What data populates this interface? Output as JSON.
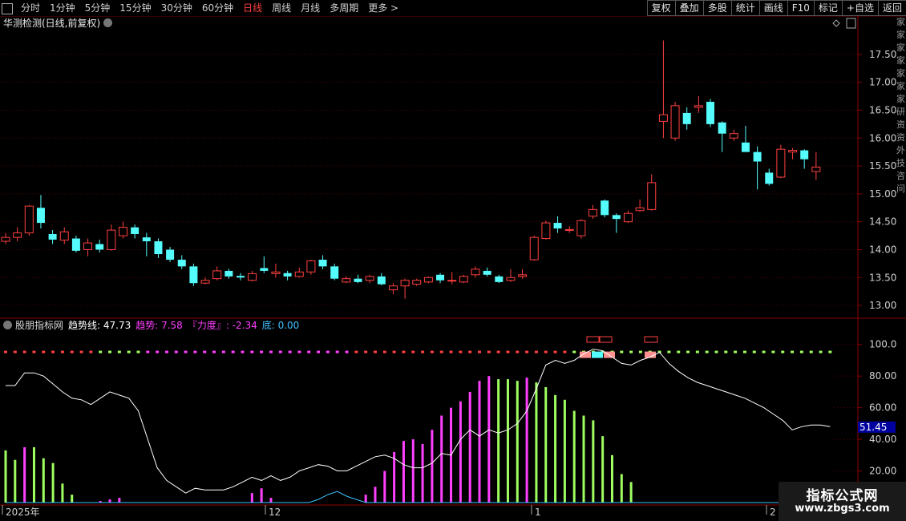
{
  "toolbar": {
    "tabs": [
      "分时",
      "1分钟",
      "5分钟",
      "15分钟",
      "30分钟",
      "60分钟",
      "日线",
      "周线",
      "月线",
      "多周期",
      "更多 >"
    ],
    "active_tab": 6,
    "right_buttons": [
      "复权",
      "叠加",
      "多股",
      "统计",
      "画线",
      "F10",
      "标记",
      "+自选",
      "返回"
    ]
  },
  "chart_title": "华测检测(日线,前复权)",
  "indicator_title": {
    "name": "股朋指标网",
    "trend_line": "趋势线: 47.73",
    "trend": "趋势: 7.58",
    "force": "『力度』: -2.34",
    "bottom": "底: 0.00"
  },
  "price_ticks": [
    "17.50",
    "17.00",
    "16.50",
    "16.00",
    "15.50",
    "15.00",
    "14.50",
    "14.00",
    "13.50",
    "13.00"
  ],
  "indicator_ticks": [
    "100.0",
    "80.00",
    "60.00",
    "40.00",
    "20.00"
  ],
  "current_value_badge": "51.45",
  "date_labels": [
    "2025年",
    "12",
    "1",
    "2"
  ],
  "right_strip": [
    "家",
    "家",
    "家",
    "家",
    "家",
    "家",
    "家",
    "研",
    "资",
    "资",
    "外",
    "技",
    "咨",
    "问"
  ],
  "watermark": {
    "line1": "指标公式网",
    "line2": "www.zbgs3.com"
  },
  "colors": {
    "up": "#ff4040",
    "down": "#54fcfc",
    "pink": "#ff40ff",
    "green": "#a0ff60",
    "axis": "#8b0000"
  },
  "chart_data": [
    {
      "type": "candlestick",
      "title": "华测检测(日线,前复权)",
      "ylim": [
        12.8,
        17.9
      ],
      "candles": [
        [
          14.15,
          14.22,
          14.3,
          14.1
        ],
        [
          14.22,
          14.3,
          14.4,
          14.15
        ],
        [
          14.3,
          14.78,
          14.8,
          14.25
        ],
        [
          14.75,
          14.48,
          14.98,
          14.38
        ],
        [
          14.28,
          14.18,
          14.35,
          14.1
        ],
        [
          14.17,
          14.32,
          14.4,
          14.1
        ],
        [
          14.2,
          13.98,
          14.25,
          13.95
        ],
        [
          14.0,
          14.12,
          14.2,
          13.88
        ],
        [
          14.1,
          14.0,
          14.18,
          13.95
        ],
        [
          14.0,
          14.35,
          14.45,
          13.98
        ],
        [
          14.25,
          14.4,
          14.5,
          14.2
        ],
        [
          14.4,
          14.28,
          14.45,
          14.2
        ],
        [
          14.22,
          14.15,
          14.3,
          13.88
        ],
        [
          14.15,
          13.92,
          14.2,
          13.85
        ],
        [
          14.0,
          13.82,
          14.05,
          13.78
        ],
        [
          13.82,
          13.7,
          13.9,
          13.65
        ],
        [
          13.7,
          13.4,
          13.75,
          13.35
        ],
        [
          13.4,
          13.45,
          13.5,
          13.38
        ],
        [
          13.48,
          13.62,
          13.7,
          13.45
        ],
        [
          13.62,
          13.52,
          13.66,
          13.48
        ],
        [
          13.53,
          13.5,
          13.58,
          13.45
        ],
        [
          13.45,
          13.57,
          13.62,
          13.43
        ],
        [
          13.67,
          13.62,
          13.88,
          13.58
        ],
        [
          13.57,
          13.6,
          13.75,
          13.5
        ],
        [
          13.58,
          13.52,
          13.62,
          13.45
        ],
        [
          13.52,
          13.6,
          13.68,
          13.5
        ],
        [
          13.6,
          13.8,
          13.82,
          13.55
        ],
        [
          13.82,
          13.7,
          13.9,
          13.65
        ],
        [
          13.7,
          13.48,
          13.75,
          13.45
        ],
        [
          13.42,
          13.48,
          13.52,
          13.4
        ],
        [
          13.48,
          13.42,
          13.55,
          13.4
        ],
        [
          13.45,
          13.52,
          13.55,
          13.4
        ],
        [
          13.52,
          13.38,
          13.58,
          13.36
        ],
        [
          13.28,
          13.35,
          13.4,
          13.2
        ],
        [
          13.35,
          13.45,
          13.48,
          13.12
        ],
        [
          13.38,
          13.45,
          13.48,
          13.35
        ],
        [
          13.42,
          13.5,
          13.52,
          13.4
        ],
        [
          13.55,
          13.45,
          13.58,
          13.4
        ],
        [
          13.45,
          13.45,
          13.6,
          13.38
        ],
        [
          13.42,
          13.52,
          13.55,
          13.4
        ],
        [
          13.55,
          13.65,
          13.7,
          13.5
        ],
        [
          13.62,
          13.55,
          13.68,
          13.52
        ],
        [
          13.52,
          13.42,
          13.55,
          13.4
        ],
        [
          13.45,
          13.5,
          13.65,
          13.42
        ],
        [
          13.52,
          13.55,
          13.65,
          13.48
        ],
        [
          13.82,
          14.22,
          14.25,
          13.8
        ],
        [
          14.2,
          14.48,
          14.52,
          14.18
        ],
        [
          14.48,
          14.38,
          14.6,
          14.3
        ],
        [
          14.36,
          14.36,
          14.42,
          14.3
        ],
        [
          14.25,
          14.52,
          14.55,
          14.2
        ],
        [
          14.6,
          14.72,
          14.8,
          14.55
        ],
        [
          14.88,
          14.62,
          14.9,
          14.58
        ],
        [
          14.62,
          14.55,
          14.65,
          14.3
        ],
        [
          14.5,
          14.65,
          14.7,
          14.48
        ],
        [
          14.7,
          14.75,
          14.9,
          14.68
        ],
        [
          14.72,
          15.2,
          15.35,
          14.7
        ],
        [
          16.3,
          16.42,
          17.75,
          16.0
        ],
        [
          16.0,
          16.58,
          16.65,
          15.95
        ],
        [
          16.45,
          16.25,
          16.55,
          16.15
        ],
        [
          16.55,
          16.58,
          16.75,
          16.45
        ],
        [
          16.65,
          16.25,
          16.7,
          16.2
        ],
        [
          16.28,
          16.08,
          16.3,
          15.75
        ],
        [
          16.0,
          16.08,
          16.15,
          15.95
        ],
        [
          15.92,
          15.75,
          16.22,
          15.75
        ],
        [
          15.75,
          15.58,
          15.85,
          15.08
        ],
        [
          15.38,
          15.18,
          15.45,
          15.15
        ],
        [
          15.3,
          15.8,
          15.88,
          15.28
        ],
        [
          15.75,
          15.78,
          15.82,
          15.62
        ],
        [
          15.78,
          15.62,
          15.8,
          15.45
        ],
        [
          15.4,
          15.48,
          15.75,
          15.25
        ]
      ]
    },
    {
      "type": "line",
      "title": "股朋指标网",
      "ylim": [
        0,
        110
      ],
      "ticks": [
        100,
        80,
        60,
        40,
        20
      ],
      "series": [
        {
          "name": "趋势线",
          "color": "#ffffff",
          "values": [
            74,
            74,
            82,
            82,
            80,
            75,
            70,
            66,
            65,
            62,
            66,
            70,
            68,
            66,
            58,
            40,
            22,
            14,
            10,
            6,
            9,
            8,
            8,
            8,
            10,
            13,
            16,
            14,
            17,
            14,
            16,
            20,
            22,
            24,
            23,
            20,
            20,
            23,
            26,
            29,
            30,
            28,
            24,
            22,
            22,
            25,
            31,
            30,
            40,
            46,
            42,
            46,
            44,
            46,
            50,
            58,
            72,
            87,
            90,
            88,
            90,
            94,
            97,
            96,
            92,
            88,
            87,
            90,
            92,
            95,
            88,
            83,
            79,
            76,
            74,
            72,
            70,
            68,
            66,
            63,
            60,
            56,
            52,
            46,
            48,
            49,
            49,
            48
          ]
        },
        {
          "name": "底",
          "color": "#40c0ff",
          "values": [
            0,
            0,
            0,
            0,
            0,
            0,
            0,
            0,
            0,
            0,
            0,
            0,
            0,
            0,
            0,
            0,
            0,
            0,
            0,
            0,
            0,
            0,
            0,
            0,
            0,
            0,
            0,
            0,
            0,
            0,
            0,
            0,
            0,
            2,
            5,
            7,
            4,
            2,
            0,
            0,
            0,
            0,
            0,
            0,
            0,
            0,
            0,
            0,
            0,
            0,
            0,
            0,
            0,
            0,
            0,
            0,
            0,
            0,
            0,
            0,
            0,
            0,
            0,
            0,
            0,
            0,
            0,
            0,
            0,
            0,
            0,
            0,
            0,
            0,
            0,
            0,
            0,
            0,
            0,
            0,
            0,
            0,
            0,
            0,
            0,
            0,
            0,
            0
          ]
        }
      ],
      "bars": [
        {
          "i": 0,
          "v": 33,
          "c": "green"
        },
        {
          "i": 1,
          "v": 27,
          "c": "green"
        },
        {
          "i": 2,
          "v": 35,
          "c": "pink"
        },
        {
          "i": 3,
          "v": 35,
          "c": "green"
        },
        {
          "i": 4,
          "v": 28,
          "c": "green"
        },
        {
          "i": 5,
          "v": 25,
          "c": "green"
        },
        {
          "i": 6,
          "v": 12,
          "c": "green"
        },
        {
          "i": 7,
          "v": 5,
          "c": "green"
        },
        {
          "i": 10,
          "v": 1,
          "c": "pink"
        },
        {
          "i": 11,
          "v": 2,
          "c": "pink"
        },
        {
          "i": 12,
          "v": 3,
          "c": "pink"
        },
        {
          "i": 26,
          "v": 6,
          "c": "pink"
        },
        {
          "i": 27,
          "v": 9,
          "c": "pink"
        },
        {
          "i": 28,
          "v": 3,
          "c": "pink"
        },
        {
          "i": 38,
          "v": 5,
          "c": "pink"
        },
        {
          "i": 39,
          "v": 10,
          "c": "pink"
        },
        {
          "i": 40,
          "v": 20,
          "c": "pink"
        },
        {
          "i": 41,
          "v": 32,
          "c": "pink"
        },
        {
          "i": 42,
          "v": 39,
          "c": "pink"
        },
        {
          "i": 43,
          "v": 40,
          "c": "pink"
        },
        {
          "i": 44,
          "v": 37,
          "c": "pink"
        },
        {
          "i": 45,
          "v": 46,
          "c": "pink"
        },
        {
          "i": 46,
          "v": 55,
          "c": "pink"
        },
        {
          "i": 47,
          "v": 60,
          "c": "pink"
        },
        {
          "i": 48,
          "v": 64,
          "c": "pink"
        },
        {
          "i": 49,
          "v": 70,
          "c": "pink"
        },
        {
          "i": 50,
          "v": 77,
          "c": "pink"
        },
        {
          "i": 51,
          "v": 80,
          "c": "pink"
        },
        {
          "i": 52,
          "v": 78,
          "c": "green"
        },
        {
          "i": 53,
          "v": 78,
          "c": "green"
        },
        {
          "i": 54,
          "v": 77,
          "c": "green"
        },
        {
          "i": 55,
          "v": 79,
          "c": "pink"
        },
        {
          "i": 56,
          "v": 76,
          "c": "green"
        },
        {
          "i": 57,
          "v": 73,
          "c": "green"
        },
        {
          "i": 58,
          "v": 68,
          "c": "green"
        },
        {
          "i": 59,
          "v": 65,
          "c": "green"
        },
        {
          "i": 60,
          "v": 58,
          "c": "green"
        },
        {
          "i": 61,
          "v": 55,
          "c": "green"
        },
        {
          "i": 62,
          "v": 52,
          "c": "green"
        },
        {
          "i": 63,
          "v": 42,
          "c": "green"
        },
        {
          "i": 64,
          "v": 30,
          "c": "green"
        },
        {
          "i": 65,
          "v": 18,
          "c": "green"
        },
        {
          "i": 66,
          "v": 13,
          "c": "green"
        }
      ]
    }
  ]
}
